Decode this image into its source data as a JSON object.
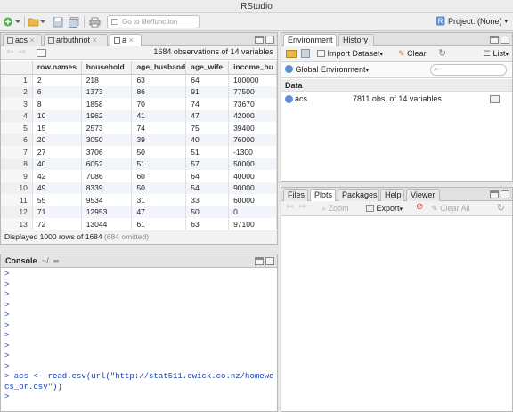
{
  "window": {
    "title": "RStudio"
  },
  "toolbar": {
    "goto_placeholder": "Go to file/function",
    "project_label": "Project: (None)"
  },
  "source": {
    "tabs": [
      {
        "label": "acs"
      },
      {
        "label": "arbuthnot"
      },
      {
        "label": "a"
      }
    ],
    "observations": "1684 observations of 14 variables",
    "columns": [
      "row.names",
      "household",
      "age_husband",
      "age_wife",
      "income_hu"
    ],
    "rows": [
      {
        "n": "1",
        "cells": [
          "2",
          "218",
          "63",
          "64",
          "100000"
        ]
      },
      {
        "n": "2",
        "cells": [
          "6",
          "1373",
          "86",
          "91",
          "77500"
        ]
      },
      {
        "n": "3",
        "cells": [
          "8",
          "1858",
          "70",
          "74",
          "73670"
        ]
      },
      {
        "n": "4",
        "cells": [
          "10",
          "1962",
          "41",
          "47",
          "42000"
        ]
      },
      {
        "n": "5",
        "cells": [
          "15",
          "2573",
          "74",
          "75",
          "39400"
        ]
      },
      {
        "n": "6",
        "cells": [
          "20",
          "3050",
          "39",
          "40",
          "76000"
        ]
      },
      {
        "n": "7",
        "cells": [
          "27",
          "3706",
          "50",
          "51",
          "-1300"
        ]
      },
      {
        "n": "8",
        "cells": [
          "40",
          "6052",
          "51",
          "57",
          "50000"
        ]
      },
      {
        "n": "9",
        "cells": [
          "42",
          "7086",
          "60",
          "64",
          "40000"
        ]
      },
      {
        "n": "10",
        "cells": [
          "49",
          "8339",
          "50",
          "54",
          "90000"
        ]
      },
      {
        "n": "11",
        "cells": [
          "55",
          "9534",
          "31",
          "33",
          "60000"
        ]
      },
      {
        "n": "12",
        "cells": [
          "71",
          "12953",
          "47",
          "50",
          "0"
        ]
      },
      {
        "n": "13",
        "cells": [
          "72",
          "13044",
          "61",
          "63",
          "97100"
        ]
      }
    ],
    "footer_main": "Displayed 1000 rows of 1684",
    "footer_omit": "(684 omitted)"
  },
  "console": {
    "title": "Console",
    "path": "~/",
    "lines": [
      ">",
      ">",
      ">",
      ">",
      ">",
      ">",
      ">",
      ">",
      ">",
      ">",
      "> acs <- read.csv(url(\"http://stat511.cwick.co.nz/homeworks/a",
      "cs_or.csv\"))",
      ">"
    ]
  },
  "environment": {
    "tabs": [
      "Environment",
      "History"
    ],
    "import_label": "Import Dataset",
    "clear_label": "Clear",
    "list_label": "List",
    "scope_label": "Global Environment",
    "data_header": "Data",
    "object_name": "acs",
    "object_desc": "7811 obs. of 14 variables"
  },
  "files": {
    "tabs": [
      "Files",
      "Plots",
      "Packages",
      "Help",
      "Viewer"
    ],
    "zoom_label": "Zoom",
    "export_label": "Export",
    "clear_all_label": "Clear All"
  }
}
